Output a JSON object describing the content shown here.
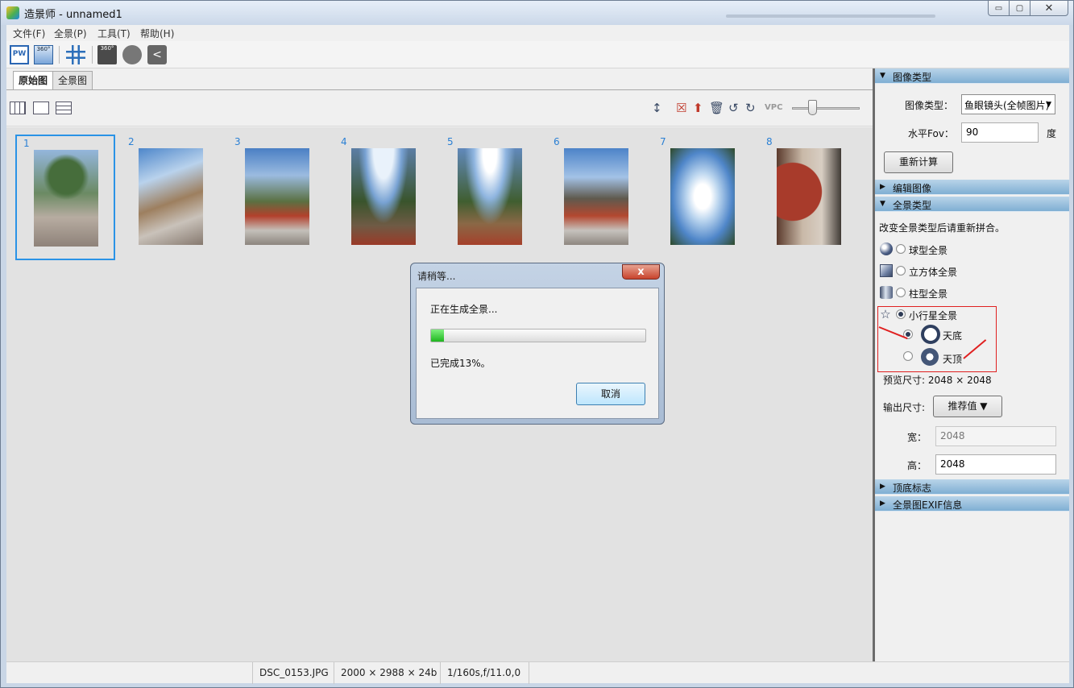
{
  "window": {
    "title": "造景师 - unnamed1",
    "controls": {
      "minimize": "▭",
      "maximize": "▢",
      "close": "✕"
    }
  },
  "menu": [
    "文件(F)",
    "全景(P)",
    "工具(T)",
    "帮助(H)"
  ],
  "toolbar": {
    "pw_label": "PW",
    "vr_label": "360°",
    "save_label": "360°",
    "share_glyph": "<"
  },
  "tabs": [
    {
      "label": "原始图",
      "active": true
    },
    {
      "label": "全景图",
      "active": false
    }
  ],
  "subtoolbar": {
    "right_icons": [
      "↕",
      "☒",
      "⬆",
      "🗑",
      "↺",
      "↻"
    ],
    "vpc_label": "VPC"
  },
  "thumbnails": [
    {
      "num": "1",
      "selected": true
    },
    {
      "num": "2",
      "selected": false
    },
    {
      "num": "3",
      "selected": false
    },
    {
      "num": "4",
      "selected": false
    },
    {
      "num": "5",
      "selected": false
    },
    {
      "num": "6",
      "selected": false
    },
    {
      "num": "7",
      "selected": false
    },
    {
      "num": "8",
      "selected": false
    }
  ],
  "panel": {
    "image_type_section": "图像类型",
    "image_type_label": "图像类型：",
    "image_type_value": "鱼眼镜头(全帧图片)",
    "fov_label": "水平Fov：",
    "fov_value": "90",
    "fov_unit": "度",
    "recalc_button": "重新计算",
    "edit_section": "编辑图像",
    "pano_type_section": "全景类型",
    "hint": "改变全景类型后请重新拼合。",
    "types": {
      "sphere": "球型全景",
      "cube": "立方体全景",
      "cylinder": "柱型全景",
      "planet": "小行星全景",
      "nadir": "天底",
      "zenith": "天顶"
    },
    "preview_size": "预览尺寸: 2048 × 2048",
    "output_label": "输出尺寸:",
    "output_button": "推荐值 ▼",
    "width_label": "宽：",
    "width_value": "2048",
    "height_label": "高：",
    "height_value": "2048",
    "nadir_zenith_section": "顶底标志",
    "exif_section": "全景图EXIF信息"
  },
  "status": {
    "filename": "DSC_0153.JPG",
    "dimensions": "2000 × 2988 × 24b",
    "exif": "1/160s,f/11.0,0"
  },
  "dialog": {
    "title": "请稍等...",
    "close": "x",
    "message": "正在生成全景...",
    "progress": 0.06,
    "done_text": "已完成13%。",
    "cancel": "取消"
  }
}
